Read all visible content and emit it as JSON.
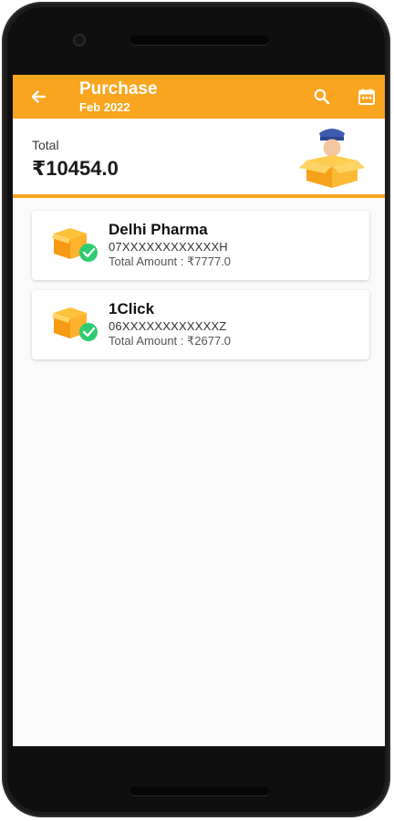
{
  "header": {
    "title": "Purchase",
    "subtitle": "Feb 2022",
    "background_color": "#f9a51f",
    "icons": [
      "back-arrow-icon",
      "search-icon",
      "calendar-icon"
    ]
  },
  "summary": {
    "label": "Total",
    "amount": "₹10454.0"
  },
  "suppliers": [
    {
      "name": "Delhi Pharma",
      "gstin": "07XXXXXXXXXXXXH",
      "amount_label": "Total Amount : ",
      "amount": "₹7777.0"
    },
    {
      "name": "1Click",
      "gstin": "06XXXXXXXXXXXXZ",
      "amount_label": "Total Amount : ",
      "amount": "₹2677.0"
    }
  ],
  "colors": {
    "accent": "#f9a51f",
    "verified_badge": "#2ecc71"
  }
}
